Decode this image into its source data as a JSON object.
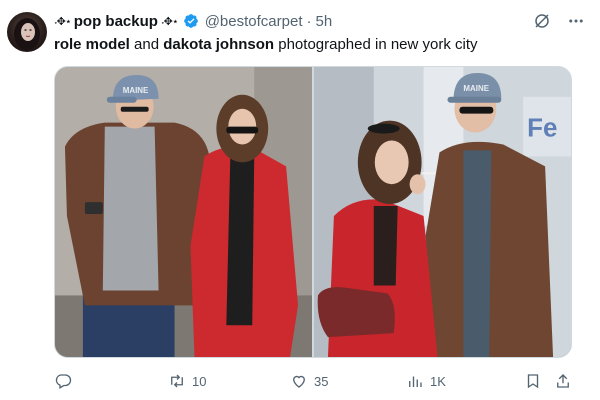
{
  "author": {
    "deco_left": "˖✥⋆",
    "display_name": "pop backup",
    "deco_right": "˖✥⋆",
    "handle": "@bestofcarpet",
    "separator": "·",
    "time": "5h"
  },
  "tweet": {
    "bold_1": "role model",
    "text_1": " and ",
    "bold_2": "dakota johnson",
    "text_2": " photographed in new york city"
  },
  "photos": {
    "left": {
      "cap_text": "MAINE"
    },
    "right": {
      "cap_text": "MAINE"
    }
  },
  "actions": {
    "reply_count": "",
    "retweet_count": "10",
    "like_count": "35",
    "views_count": "1K"
  },
  "colors": {
    "verified": "#1d9bf0",
    "text_secondary": "#536471",
    "text_primary": "#0f1419"
  },
  "icons": {
    "grok": "grok-icon",
    "more": "more-icon",
    "reply": "reply-icon",
    "retweet": "retweet-icon",
    "like": "like-icon",
    "views": "views-icon",
    "bookmark": "bookmark-icon",
    "share": "share-icon"
  }
}
